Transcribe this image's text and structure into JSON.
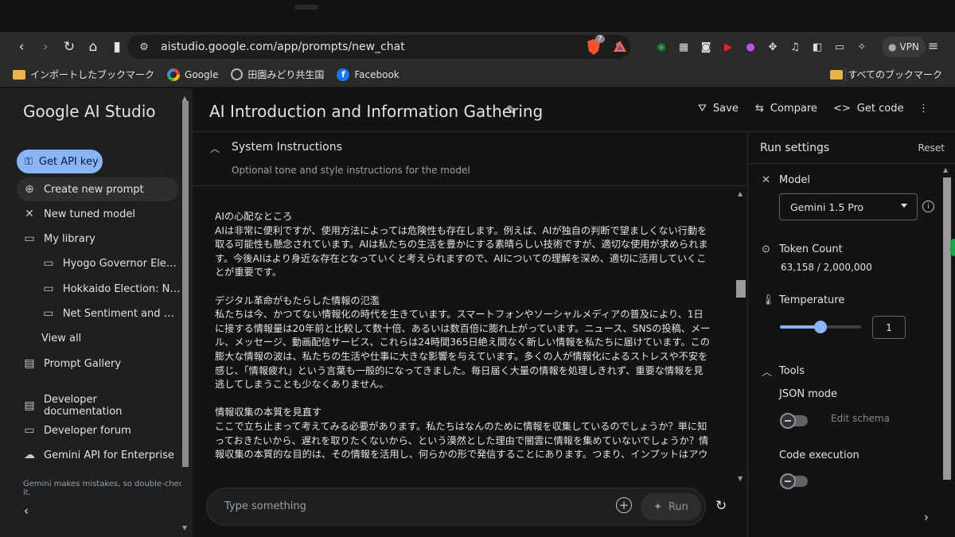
{
  "browser": {
    "url": "aistudio.google.com/app/prompts/new_chat",
    "brave_badge": "7",
    "vpn_label": "VPN",
    "bookmarks": [
      {
        "label": "インポートしたブックマーク",
        "icon": "folder-icon"
      },
      {
        "label": "Google",
        "icon": "google-icon"
      },
      {
        "label": "田園みどり共生国",
        "icon": "globe-icon"
      },
      {
        "label": "Facebook",
        "icon": "facebook-icon"
      }
    ],
    "all_bookmarks": "すべてのブックマーク"
  },
  "sidebar": {
    "brand": "Google AI Studio",
    "api_key": "Get API key",
    "items": [
      {
        "label": "Create new prompt",
        "icon": "plus-circle-icon"
      },
      {
        "label": "New tuned model",
        "icon": "tune-icon"
      },
      {
        "label": "My library",
        "icon": "folder-icon"
      }
    ],
    "library": [
      "Hyogo Governor Election Res…",
      "Hokkaido Election: Net Se…",
      "Net Sentiment and Hokkai…"
    ],
    "view_all": "View all",
    "prompt_gallery": "Prompt Gallery",
    "links": [
      "Developer documentation",
      "Developer forum",
      "Gemini API for Enterprise"
    ],
    "disclaimer": "Gemini makes mistakes, so double-check it."
  },
  "header": {
    "title": "AI Introduction and Information Gathering",
    "save": "Save",
    "compare": "Compare",
    "get_code": "Get code"
  },
  "system_instructions": {
    "label": "System Instructions",
    "placeholder": "Optional tone and style instructions for the model"
  },
  "content": {
    "paragraphs": [
      {
        "heading": "AIの心配なところ",
        "lines": [
          "AIは非常に便利ですが、使用方法によっては危険性も存在します。例えば、AIが独自の判断で望ましくない行動を",
          "取る可能性も懸念されています。AIは私たちの生活を豊かにする素晴らしい技術ですが、適切な使用が求められま",
          "す。今後AIはより身近な存在となっていくと考えられますので、AIについての理解を深め、適切に活用していくこ",
          "とが重要です。"
        ]
      },
      {
        "heading": "デジタル革命がもたらした情報の氾濫",
        "lines": [
          "私たちは今、かつてない情報化の時代を生きています。スマートフォンやソーシャルメディアの普及により、1日",
          "に接する情報量は20年前と比較して数十倍、あるいは数百倍に膨れ上がっています。ニュース、SNSの投稿、メー",
          "ル、メッセージ、動画配信サービス、これらは24時間365日絶え間なく新しい情報を私たちに届けています。この",
          "膨大な情報の波は、私たちの生活や仕事に大きな影響を与えています。多くの人が情報化によるストレスや不安を",
          "感じ、「情報疲れ」という言葉も一般的になってきました。毎日届く大量の情報を処理しきれず、重要な情報を見",
          "逃してしまうことも少なくありません。"
        ]
      },
      {
        "heading": "情報収集の本質を見直す",
        "lines": [
          "ここで立ち止まって考えてみる必要があります。私たちはなんのために情報を収集しているのでしょうか？単に知",
          "っておきたいから、遅れを取りたくないから、という漠然とした理由で闇雲に情報を集めていないでしょうか？情",
          "報収集の本質的な目的は、その情報を活用し、何らかの形で発信することにあります。つまり、インプットはアウ"
        ]
      }
    ]
  },
  "input": {
    "placeholder": "Type something",
    "run": "Run"
  },
  "run_settings": {
    "title": "Run settings",
    "reset": "Reset",
    "model_label": "Model",
    "model_value": "Gemini 1.5 Pro",
    "token_label": "Token Count",
    "token_value": "63,158 / 2,000,000",
    "temperature_label": "Temperature",
    "temperature_value": "1",
    "temperature_fraction": 0.5,
    "tools_label": "Tools",
    "json_mode": "JSON mode",
    "edit_schema": "Edit schema",
    "code_execution": "Code execution"
  }
}
